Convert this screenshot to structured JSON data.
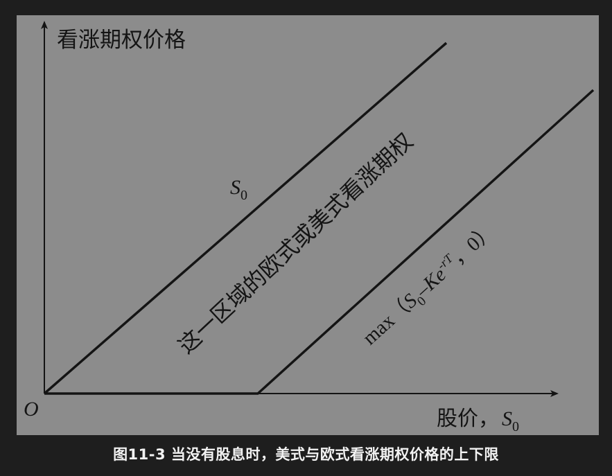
{
  "figure": {
    "y_axis_label": "看涨期权价格",
    "x_axis_label_text": "股价，",
    "x_axis_label_var": "S",
    "x_axis_label_sub": "0",
    "origin_label": "O",
    "upper_bound_label_var": "S",
    "upper_bound_label_sub": "0",
    "region_label": "这一区域的欧式或美式看涨期权",
    "lower_bound_label": {
      "prefix": "max（",
      "s": "S",
      "s_sub": "0",
      "minus": "–",
      "k": "Ke",
      "exp": "-rT",
      "suffix": "，0）"
    }
  },
  "caption": "图11-3 当没有股息时，美式与欧式看涨期权价格的上下限"
}
